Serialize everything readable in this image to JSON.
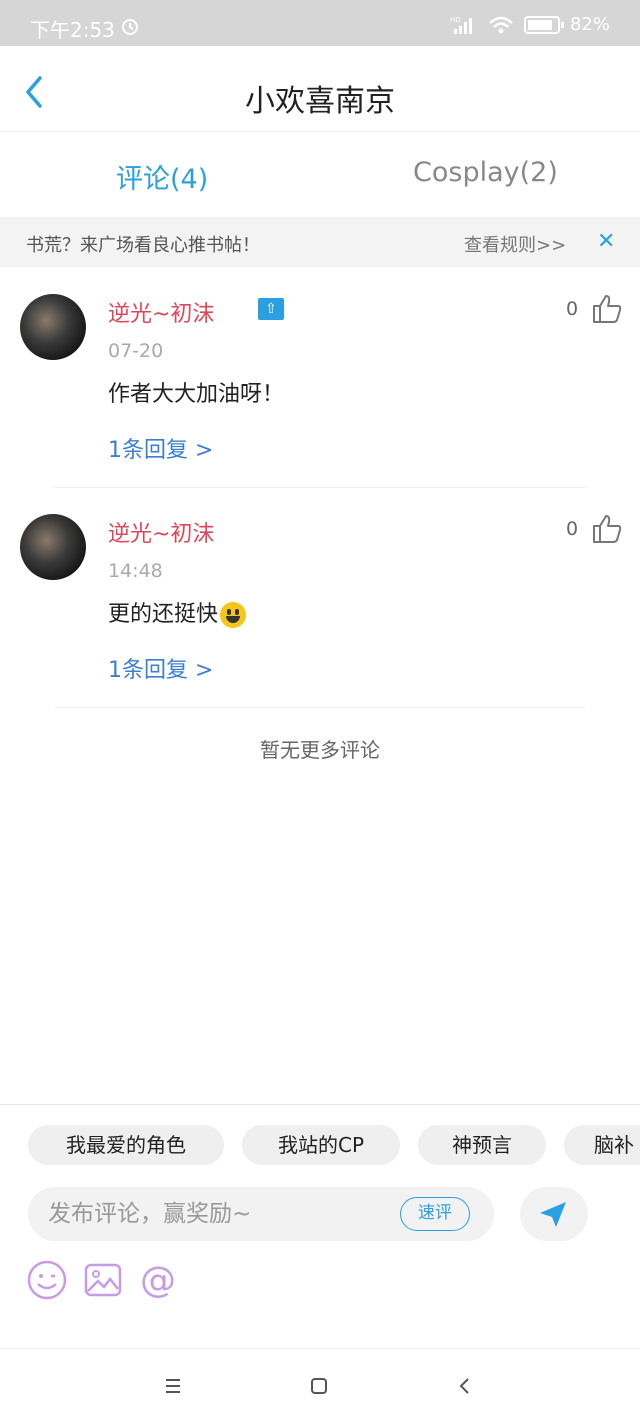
{
  "status_bar": {
    "time": "下午2:53",
    "network": "HD",
    "battery": "82%"
  },
  "header": {
    "title": "小欢喜南京"
  },
  "tabs": [
    {
      "label": "评论(4)",
      "active": true
    },
    {
      "label": "Cosplay(2)",
      "active": false
    }
  ],
  "notice": {
    "text": "书荒？来广场看良心推书帖！",
    "rules_link": "查看规则>>"
  },
  "comments": [
    {
      "username": "逆光~初沫",
      "badge": "⇧",
      "date": "07-20",
      "content": "作者大大加油呀！",
      "replies": "1条回复 >",
      "likes": "0"
    },
    {
      "username": "逆光~初沫",
      "date": "14:48",
      "content": "更的还挺快",
      "emoji": "smiley-emoji",
      "replies": "1条回复 >",
      "likes": "0"
    }
  ],
  "footer_note": "暂无更多评论",
  "quick_tags": [
    "我最爱的角色",
    "我站的CP",
    "神预言",
    "脑补"
  ],
  "composer": {
    "placeholder": "发布评论，赢奖励~",
    "quick_comment_label": "速评",
    "tools": [
      "emoji-icon",
      "image-icon",
      "at-icon"
    ]
  },
  "colors": {
    "accent": "#2aa0e0",
    "username": "#e0465a",
    "link": "#3b7fd0"
  }
}
